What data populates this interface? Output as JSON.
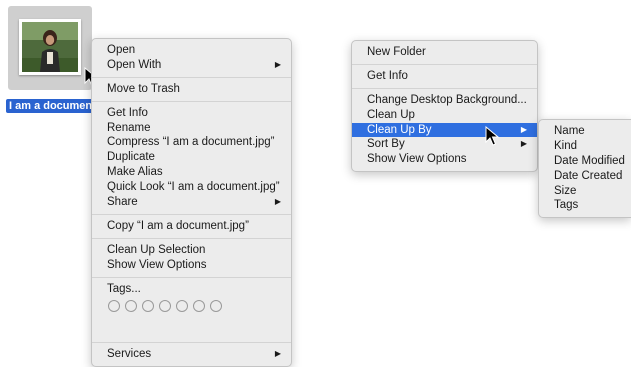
{
  "file": {
    "label": "I am a document."
  },
  "file_menu": {
    "groups": [
      [
        {
          "label": "Open",
          "submenu": false
        },
        {
          "label": "Open With",
          "submenu": true
        }
      ],
      [
        {
          "label": "Move to Trash",
          "submenu": false
        }
      ],
      [
        {
          "label": "Get Info",
          "submenu": false
        },
        {
          "label": "Rename",
          "submenu": false
        },
        {
          "label": "Compress “I am a document.jpg”",
          "submenu": false
        },
        {
          "label": "Duplicate",
          "submenu": false
        },
        {
          "label": "Make Alias",
          "submenu": false
        },
        {
          "label": "Quick Look “I am a document.jpg”",
          "submenu": false
        },
        {
          "label": "Share",
          "submenu": true
        }
      ],
      [
        {
          "label": "Copy “I am a document.jpg”",
          "submenu": false
        }
      ],
      [
        {
          "label": "Clean Up Selection",
          "submenu": false
        },
        {
          "label": "Show View Options",
          "submenu": false
        }
      ]
    ],
    "tags_label": "Tags...",
    "tag_count": 7,
    "services_label": "Services"
  },
  "desktop_menu": {
    "groups": [
      [
        {
          "label": "New Folder",
          "submenu": false,
          "highlighted": false
        }
      ],
      [
        {
          "label": "Get Info",
          "submenu": false,
          "highlighted": false
        }
      ],
      [
        {
          "label": "Change Desktop Background...",
          "submenu": false,
          "highlighted": false
        },
        {
          "label": "Clean Up",
          "submenu": false,
          "highlighted": false
        },
        {
          "label": "Clean Up By",
          "submenu": true,
          "highlighted": true
        },
        {
          "label": "Sort By",
          "submenu": true,
          "highlighted": false
        },
        {
          "label": "Show View Options",
          "submenu": false,
          "highlighted": false
        }
      ]
    ]
  },
  "cleanup_submenu": {
    "items": [
      "Name",
      "Kind",
      "Date Modified",
      "Date Created",
      "Size",
      "Tags"
    ]
  },
  "colors": {
    "highlight": "#2f6fe0",
    "label_selection": "#2a63d0",
    "menu_bg": "#ececec"
  },
  "icons": {
    "submenu_arrow": "▶"
  }
}
